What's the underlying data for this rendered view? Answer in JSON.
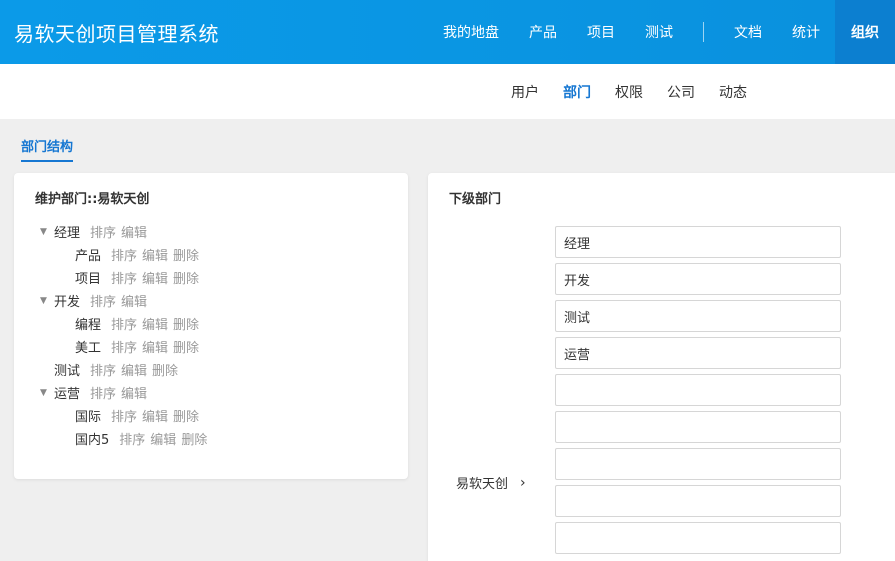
{
  "header": {
    "brand": "易软天创项目管理系统",
    "nav": [
      "我的地盘",
      "产品",
      "项目",
      "测试"
    ],
    "nav_right": [
      "文档",
      "统计",
      "组织"
    ],
    "active": "组织"
  },
  "subnav": {
    "items": [
      "用户",
      "部门",
      "权限",
      "公司",
      "动态"
    ],
    "active": "部门"
  },
  "page_tab": "部门结构",
  "left_panel": {
    "title": "维护部门::易软天创",
    "actions": {
      "sort": "排序",
      "edit": "编辑",
      "delete": "删除"
    },
    "tree": [
      {
        "name": "经理",
        "children": [
          "产品",
          "项目"
        ]
      },
      {
        "name": "开发",
        "children": [
          "编程",
          "美工"
        ]
      },
      {
        "name": "测试",
        "children": []
      },
      {
        "name": "运营",
        "children": [
          "国际",
          "国内5"
        ]
      }
    ]
  },
  "right_panel": {
    "title": "下级部门",
    "parent": "易软天创",
    "chevron": "›",
    "inputs": [
      "经理",
      "开发",
      "测试",
      "运营",
      "",
      "",
      "",
      "",
      ""
    ]
  },
  "colors": {
    "accent": "#1677d2",
    "header": "#0b9ae8",
    "active_nav": "#0c7fd0"
  }
}
